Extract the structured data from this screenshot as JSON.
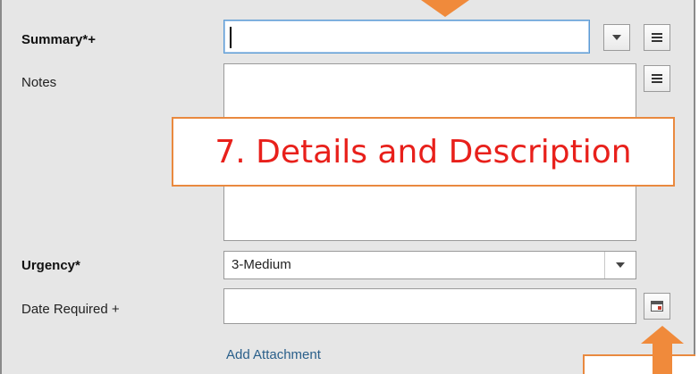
{
  "form": {
    "summary": {
      "label": "Summary*+",
      "value": ""
    },
    "notes": {
      "label": "Notes",
      "value": ""
    },
    "urgency": {
      "label": "Urgency*",
      "value": "3-Medium"
    },
    "date_required": {
      "label": "Date Required +",
      "value": ""
    },
    "add_attachment": "Add Attachment"
  },
  "callout": {
    "text": "7. Details and Description"
  },
  "icons": {
    "summary_dropdown": "chevron-down-icon",
    "summary_expand": "list-icon",
    "notes_expand": "list-icon",
    "urgency_dropdown": "chevron-down-icon",
    "date_picker": "calendar-icon"
  },
  "colors": {
    "callout_border": "#e9893f",
    "callout_text": "#e8201b",
    "arrow": "#f08a3b",
    "link": "#2a5f8a"
  }
}
